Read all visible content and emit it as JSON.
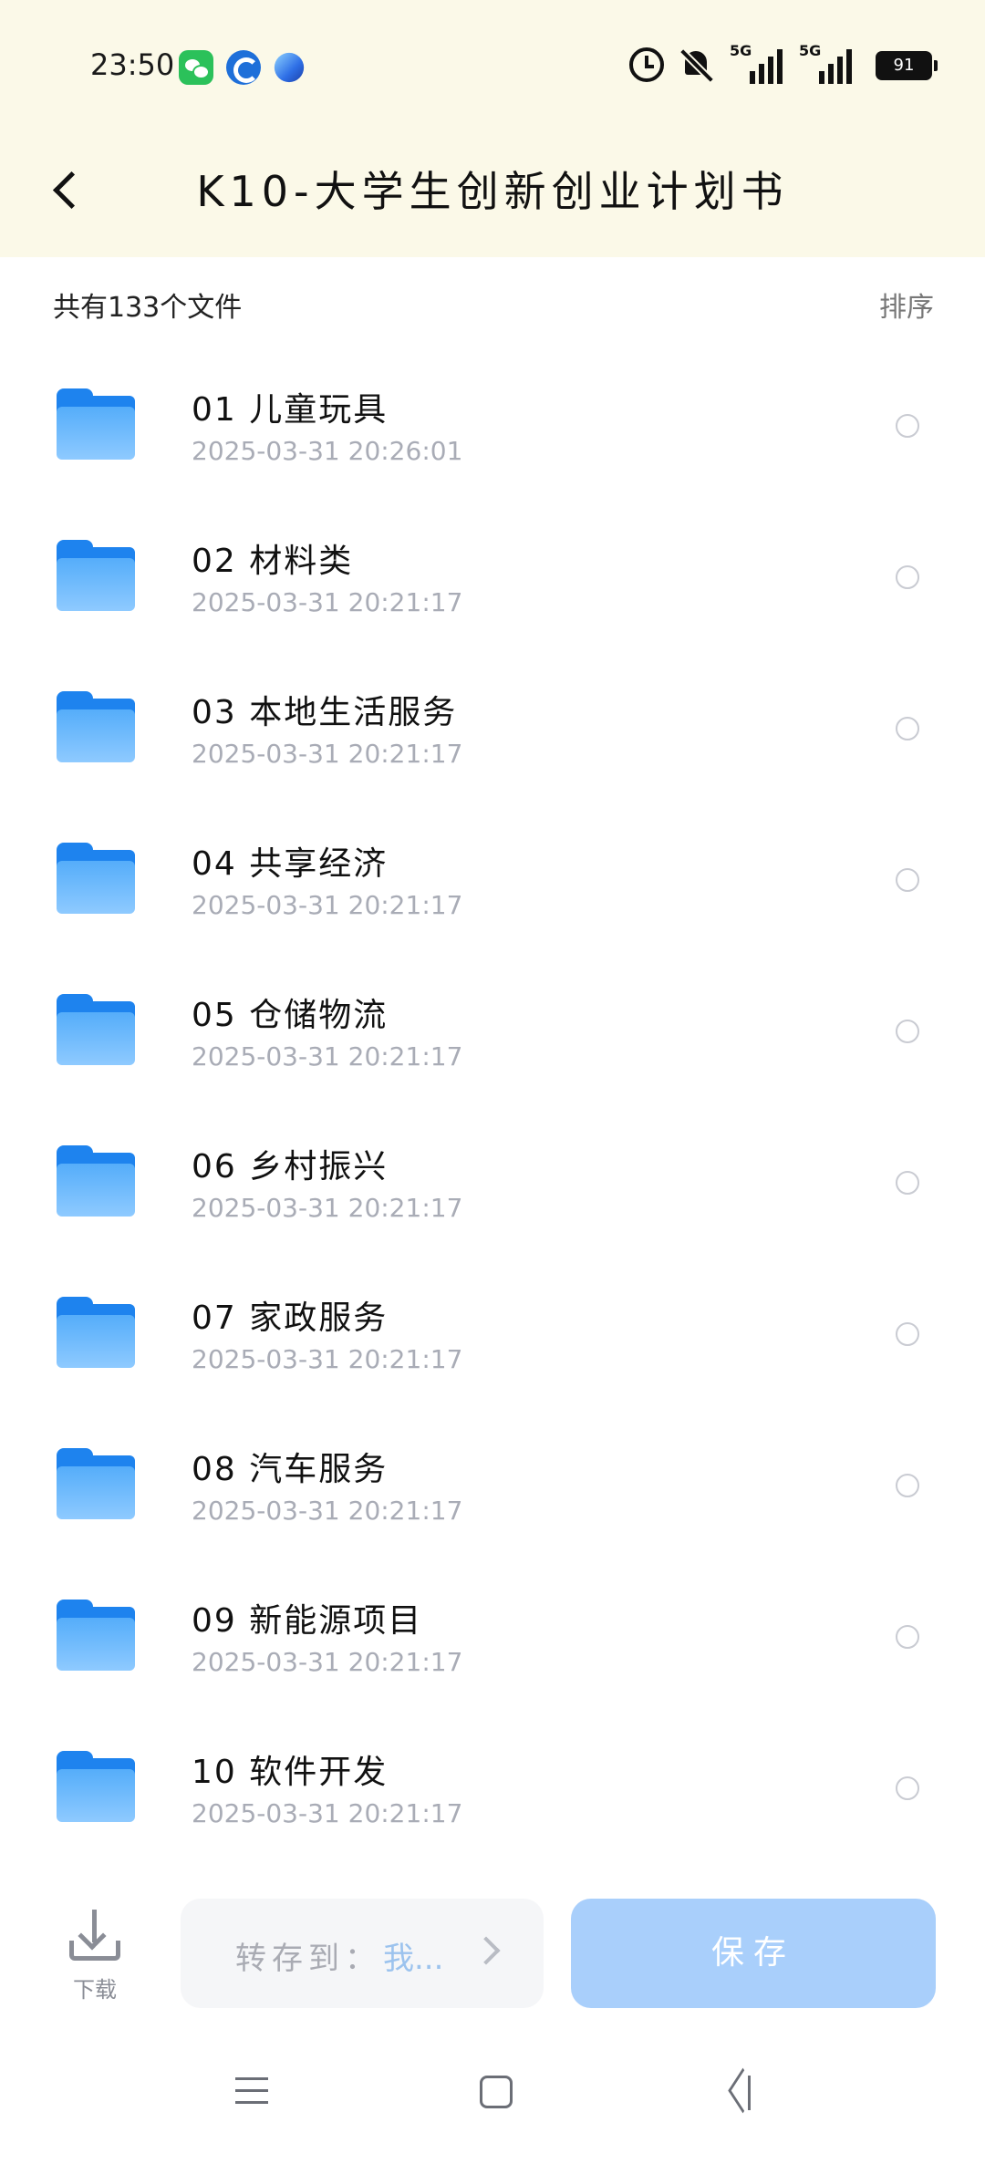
{
  "status_bar": {
    "time": "23:50",
    "signal1": "5G",
    "signal2": "5G",
    "battery": "91",
    "icons": [
      "wechat-icon",
      "blue-c-icon",
      "orb-icon",
      "alarm-icon",
      "mute-icon",
      "signal-icon",
      "battery-icon"
    ]
  },
  "header": {
    "title": "K10-大学生创新创业计划书",
    "back_icon": "chevron-left-icon"
  },
  "summary": {
    "count_text": "共有133个文件",
    "sort_label": "排序"
  },
  "files": [
    {
      "name": "01 儿童玩具",
      "date": "2025-03-31  20:26:01"
    },
    {
      "name": "02 材料类",
      "date": "2025-03-31  20:21:17"
    },
    {
      "name": "03 本地生活服务",
      "date": "2025-03-31  20:21:17"
    },
    {
      "name": "04 共享经济",
      "date": "2025-03-31  20:21:17"
    },
    {
      "name": "05 仓储物流",
      "date": "2025-03-31  20:21:17"
    },
    {
      "name": "06 乡村振兴",
      "date": "2025-03-31  20:21:17"
    },
    {
      "name": "07 家政服务",
      "date": "2025-03-31  20:21:17"
    },
    {
      "name": "08 汽车服务",
      "date": "2025-03-31  20:21:17"
    },
    {
      "name": "09 新能源项目",
      "date": "2025-03-31  20:21:17"
    },
    {
      "name": "10 软件开发",
      "date": "2025-03-31  20:21:17"
    }
  ],
  "actions": {
    "download_label": "下载",
    "transfer_label": "转存到：",
    "transfer_target": "我...",
    "save_label": "保存"
  },
  "colors": {
    "header_bg": "#fbf9e8",
    "folder_blue": "#1e83ee",
    "save_button": "#a9cffb",
    "date_gray": "#a9acb6"
  }
}
